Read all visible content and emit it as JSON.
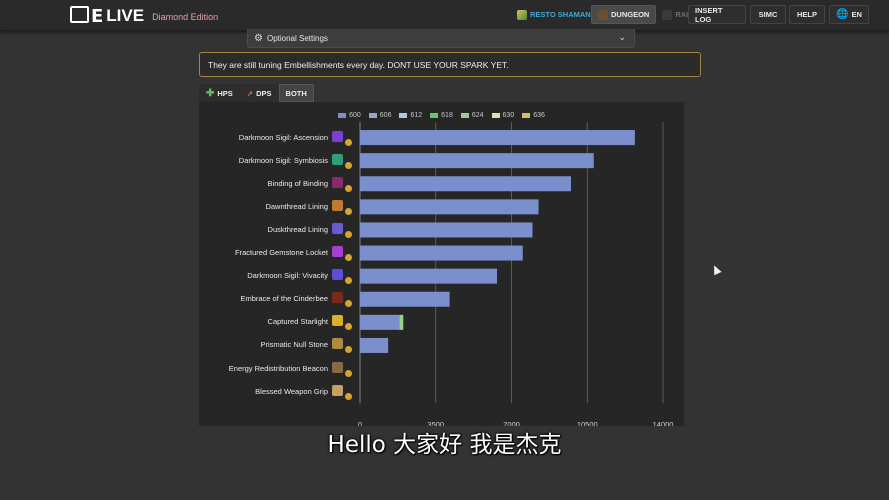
{
  "app": {
    "logo_mark": "QE",
    "logo_live": "LIVE",
    "edition": "Diamond Edition"
  },
  "nav": {
    "spec": "RESTO SHAMAN",
    "dungeon": "DUNGEON",
    "raid": "RAID",
    "insert_log": "INSERT LOG",
    "simc": "SIMC",
    "help": "HELP",
    "language": "EN"
  },
  "optional_settings": {
    "label": "Optional Settings"
  },
  "notice": "They are still tuning Embellishments every day. DONT USE YOUR SPARK YET.",
  "tabs": [
    {
      "label": "HPS",
      "active": false
    },
    {
      "label": "DPS",
      "active": false
    },
    {
      "label": "BOTH",
      "active": true
    }
  ],
  "subtitle": "Hello 大家好 我是杰克",
  "colors": {
    "bar": "#7a90cc",
    "accent_green": "#9bd089",
    "notice_border": "#a28540"
  },
  "chart_data": {
    "type": "bar",
    "orientation": "horizontal",
    "stacked": true,
    "legend_position": "top",
    "grid": true,
    "xlim": [
      0,
      14000
    ],
    "xticks": [
      "0",
      "3500",
      "7000",
      "10500",
      "14000"
    ],
    "legend": [
      {
        "name": "600",
        "color": "#7a90cc"
      },
      {
        "name": "606",
        "color": "#94a3c9"
      },
      {
        "name": "612",
        "color": "#b4c4e4"
      },
      {
        "name": "618",
        "color": "#6ec26a"
      },
      {
        "name": "624",
        "color": "#9bd089"
      },
      {
        "name": "630",
        "color": "#c9e9b4"
      },
      {
        "name": "636",
        "color": "#d9b96a"
      }
    ],
    "categories": [
      "Darkmoon Sigil: Ascension",
      "Darkmoon Sigil: Symbiosis",
      "Binding of Binding",
      "Dawnthread Lining",
      "Duskthread Lining",
      "Fractured Gemstone Locket",
      "Darkmoon Sigil: Vivacity",
      "Embrace of the Cinderbee",
      "Captured Starlight",
      "Prismatic Null Stone",
      "Energy Redistribution Beacon",
      "Blessed Weapon Grip"
    ],
    "icons": [
      "sigil-ascension-icon",
      "sigil-symbiosis-icon",
      "binding-icon",
      "dawnthread-icon",
      "duskthread-icon",
      "gemstone-locket-icon",
      "sigil-vivacity-icon",
      "cinderbee-icon",
      "starlight-icon",
      "null-stone-icon",
      "beacon-icon",
      "weapon-grip-icon"
    ],
    "icon_colors": [
      "#7b3fd6",
      "#2f9e7a",
      "#8a2a6a",
      "#c07a30",
      "#6a5ad0",
      "#a63fd0",
      "#5b4fd6",
      "#7a2a1a",
      "#d8b02a",
      "#b08a40",
      "#8a6a40",
      "#c8a060"
    ],
    "series": [
      {
        "name": "600",
        "values": [
          12700,
          10800,
          9750,
          8250,
          7970,
          7520,
          6330,
          4140,
          1820,
          1300,
          0,
          0
        ]
      },
      {
        "name": "606",
        "values": [
          0,
          0,
          0,
          0,
          0,
          0,
          0,
          0,
          0,
          0,
          0,
          0
        ]
      },
      {
        "name": "612",
        "values": [
          0,
          0,
          0,
          0,
          0,
          0,
          0,
          0,
          0,
          0,
          0,
          0
        ]
      },
      {
        "name": "618",
        "values": [
          0,
          0,
          0,
          0,
          0,
          0,
          0,
          0,
          0,
          0,
          0,
          0
        ]
      },
      {
        "name": "624",
        "values": [
          0,
          0,
          0,
          0,
          0,
          0,
          0,
          0,
          180,
          0,
          0,
          0
        ]
      },
      {
        "name": "630",
        "values": [
          0,
          0,
          0,
          0,
          0,
          0,
          0,
          0,
          0,
          0,
          0,
          0
        ]
      },
      {
        "name": "636",
        "values": [
          0,
          0,
          0,
          0,
          0,
          0,
          0,
          0,
          0,
          0,
          0,
          0
        ]
      }
    ]
  }
}
